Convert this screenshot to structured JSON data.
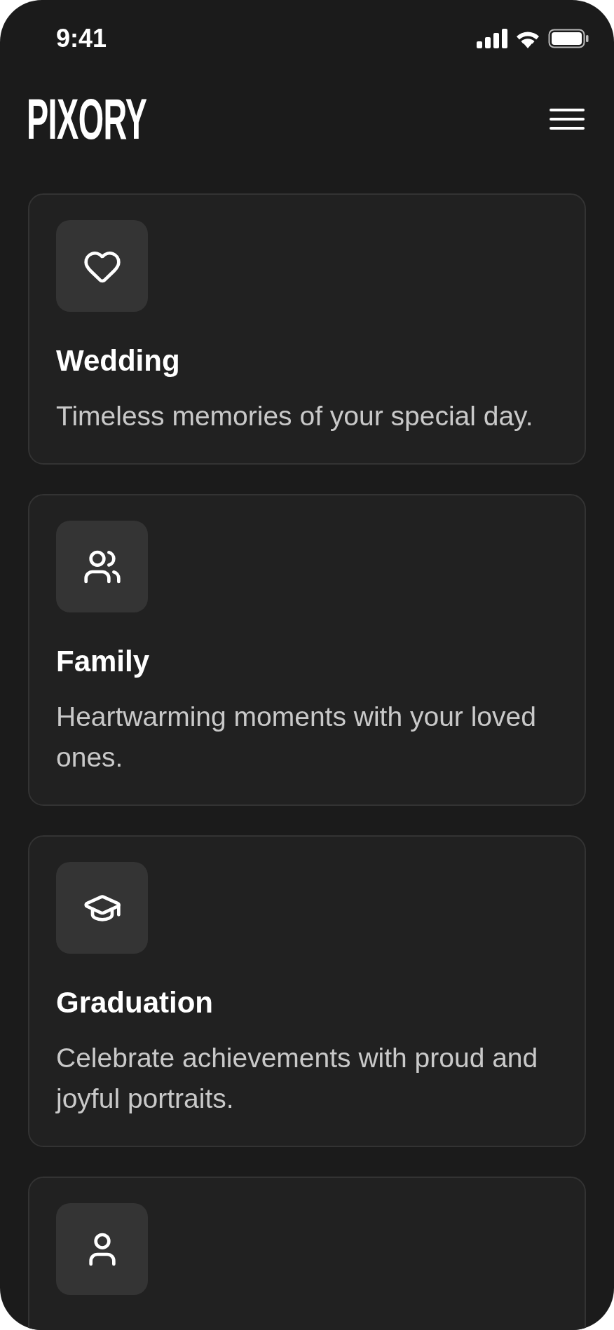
{
  "status_bar": {
    "time": "9:41"
  },
  "header": {
    "logo": "PIXORY"
  },
  "cards": [
    {
      "kind": "full",
      "title": "Wedding",
      "description": "Timeless memories of your special day."
    },
    {
      "kind": "full",
      "title": "Family",
      "description": "Heartwarming moments with your loved ones."
    },
    {
      "kind": "full",
      "title": "Graduation",
      "description": "Celebrate achievements with proud and joyful portraits."
    },
    {
      "kind": "cut_off"
    }
  ]
}
